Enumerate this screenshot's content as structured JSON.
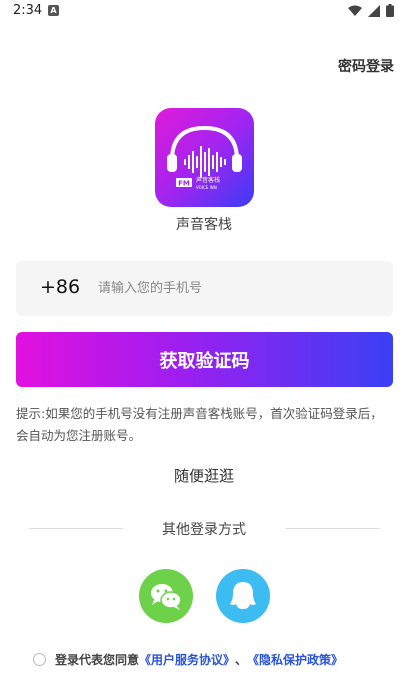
{
  "status": {
    "time": "2:34",
    "notif_letter": "A"
  },
  "header": {
    "password_login": "密码登录"
  },
  "app": {
    "name": "声音客栈",
    "logo_badge": "FM",
    "logo_text_cn": "声音客栈",
    "logo_text_en": "VOICE INN"
  },
  "phone": {
    "prefix": "+86",
    "placeholder": "请输入您的手机号",
    "value": ""
  },
  "actions": {
    "get_code": "获取验证码",
    "browse": "随便逛逛"
  },
  "tip": "提示:如果您的手机号没有注册声音客栈账号，首次验证码登录后，会自动为您注册账号。",
  "other_login": {
    "title": "其他登录方式",
    "wechat_icon": "wechat-icon",
    "qq_icon": "qq-icon"
  },
  "agreement": {
    "prefix": "登录代表您同意",
    "user_agreement": "《用户服务协议》",
    "separator": "、",
    "privacy_policy": "《隐私保护政策》"
  },
  "colors": {
    "gradient_start": "#e210e0",
    "gradient_end": "#3a40f5",
    "wechat": "#6dd24a",
    "qq": "#3cbcf0",
    "link": "#2a55d6"
  }
}
